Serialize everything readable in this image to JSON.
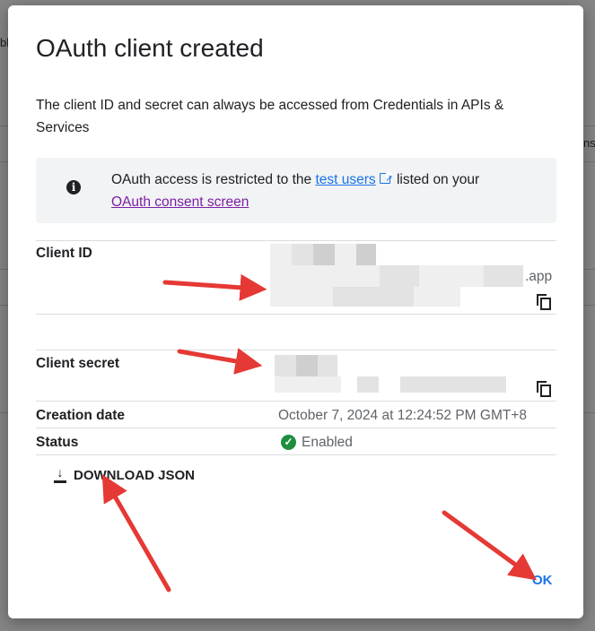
{
  "dialog": {
    "title": "OAuth client created",
    "description": "The client ID and secret can always be accessed from Credentials in APIs & Services",
    "info": {
      "text_before": "OAuth access is restricted to the ",
      "test_users_link": "test users",
      "text_after": " listed on your ",
      "consent_link": "OAuth consent screen"
    },
    "fields": {
      "client_id_label": "Client ID",
      "client_id_suffix": ".app",
      "client_secret_label": "Client secret",
      "creation_date_label": "Creation date",
      "creation_date_value": "October 7, 2024 at 12:24:52 PM GMT+8",
      "status_label": "Status",
      "status_value": "Enabled"
    },
    "download_label": "DOWNLOAD JSON",
    "ok_label": "OK"
  },
  "background": {
    "partial_text_left": "ble",
    "partial_text_right": "ns"
  },
  "icons": [
    "info-icon",
    "open-in-new-icon",
    "copy-icon",
    "check-circle-icon",
    "download-icon"
  ],
  "colors": {
    "link": "#1a73e8",
    "visited_link": "#7b1fa2",
    "status_green": "#1e8e3e",
    "annotation_arrow": "#e53935"
  }
}
